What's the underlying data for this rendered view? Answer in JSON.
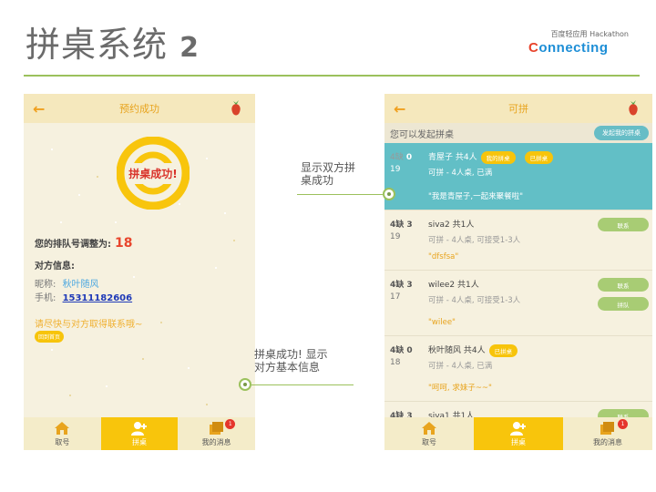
{
  "slide": {
    "title": "拼桌系统",
    "title_num": "2",
    "logo_top": "百度轻应用 Hackathon",
    "logo_word_a": "C",
    "logo_word_b": "onnecting"
  },
  "left_screen": {
    "nav_title": "预约成功",
    "badge_text": "拼桌成功!",
    "queue_label": "您的排队号调整为:",
    "queue_value": "18",
    "partner_label": "对方信息:",
    "nick_label": "昵称:",
    "nick_value": "秋叶随风",
    "phone_label": "手机:",
    "phone_value": "15311182606",
    "contact_hint": "请尽快与对方取得联系哦~",
    "home_button": "回到首页"
  },
  "right_screen": {
    "nav_title": "可拼",
    "subbar_text": "您可以发起拼桌",
    "launch_button": "发起我的拼桌",
    "rows": [
      {
        "need": "4缺",
        "need_n": "0",
        "qnum": "19",
        "title": "青屋子 共4人",
        "tag1": "我的拼桌",
        "tag2": "已拼桌",
        "status": "可拼 - 4人桌,   已满",
        "quote": "\"我是青屋子,一起来聚餐啦\""
      },
      {
        "need": "4缺",
        "need_n": "3",
        "qnum": "19",
        "title": "siva2 共1人",
        "status": "可拼 - 4人桌,  可接受1-3人",
        "quote": "\"dfsfsa\"",
        "btn1": "联系"
      },
      {
        "need": "4缺",
        "need_n": "3",
        "qnum": "17",
        "title": "wilee2 共1人",
        "status": "可拼 - 4人桌,  可接受1-3人",
        "quote": "\"wilee\"",
        "btn1": "联系",
        "btn2": "拼队"
      },
      {
        "need": "4缺",
        "need_n": "0",
        "qnum": "18",
        "title": "秋叶随风 共4人",
        "tag1": "已拼桌",
        "status": "可拼 - 4人桌,   已满",
        "quote": "\"呵呵, 求妹子~~\""
      },
      {
        "need": "4缺",
        "need_n": "3",
        "title": "siva1 共1人",
        "btn1": "联系"
      }
    ]
  },
  "tabbar": {
    "tab1": "取号",
    "tab2": "拼桌",
    "tab3": "我的消息",
    "badge": "1"
  },
  "annotations": {
    "right_note": "显示双方拼\n桌成功",
    "left_note": "拼桌成功! 显示\n对方基本信息"
  },
  "colors": {
    "accent_yellow": "#f8c50c",
    "teal_highlight": "#62bfc6",
    "green_rule": "#9bc15c"
  }
}
